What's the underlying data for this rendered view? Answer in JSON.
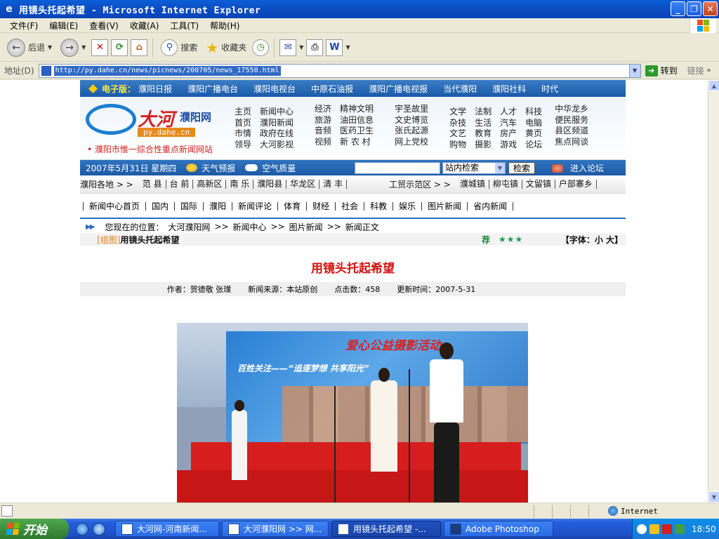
{
  "window": {
    "title": "用镜头托起希望 - Microsoft Internet Explorer",
    "buttons": [
      "_",
      "❐",
      "✕"
    ]
  },
  "menu": [
    "文件(F)",
    "编辑(E)",
    "查看(V)",
    "收藏(A)",
    "工具(T)",
    "帮助(H)"
  ],
  "toolbar": {
    "back": "后退",
    "search": "搜索",
    "favorites": "收藏夹"
  },
  "address": {
    "label": "地址(D)",
    "url": "http://py.dahe.cn/news/picnews/200705/news_17550.html",
    "go": "转到",
    "links": "链接"
  },
  "site": {
    "epaper_label": "电子版：",
    "epaper_items": [
      "濮阳日报",
      "濮阳广播电台",
      "濮阳电视台",
      "中原石油报",
      "濮阳广播电视报",
      "当代濮阳",
      "濮阳社科",
      "时代"
    ],
    "logo_big": "大河",
    "logo_small": "濮阳网",
    "logo_domain": "py.dahe.cn",
    "slogan": "• 濮阳市惟一综合性重点新闻网站",
    "nav_cols": [
      [
        "主页",
        "首页",
        "市情",
        "领导"
      ],
      [
        "新闻中心",
        "濮阳新闻",
        "政府在线",
        "大河影视"
      ],
      [
        "经济",
        "旅游",
        "音频",
        "视频"
      ],
      [
        "精神文明",
        "油田信息",
        "医药卫生",
        "新 农 村"
      ],
      [
        "宇圣故里",
        "文史博览",
        "张氏起源",
        "网上党校"
      ],
      [
        "文学",
        "杂技",
        "文艺",
        "购物"
      ],
      [
        "法制",
        "生活",
        "教育",
        "摄影"
      ],
      [
        "人才",
        "汽车",
        "房产",
        "游戏"
      ],
      [
        "科技",
        "电脑",
        "黄页",
        "论坛"
      ],
      [
        "中华龙乡",
        "便民服务",
        "县区频道",
        "焦点网谈"
      ]
    ],
    "date": "2007年5月31日 星期四",
    "weather": "天气预报",
    "air": "空气质量",
    "search_select": "站内检索",
    "search_button": "检索",
    "forum": "进入论坛",
    "region_label": "濮阳各地 > >",
    "regions": [
      "范 县",
      "台 前",
      "高新区",
      "南 乐",
      "濮阳县",
      "华龙区",
      "清 丰"
    ],
    "zone_label": "工贸示范区 > >",
    "zones": [
      "濮城镇",
      "柳屯镇",
      "文留镇",
      "户部寨乡"
    ],
    "categories": [
      "新闻中心首页",
      "国内",
      "国际",
      "濮阳",
      "新闻评论",
      "体育",
      "财经",
      "社会",
      "科教",
      "娱乐",
      "图片新闻",
      "省内新闻"
    ],
    "crumb_prefix": "您现在的位置：",
    "crumbs": [
      "大河濮阳网",
      "新闻中心",
      "图片新闻",
      "新闻正文"
    ],
    "article_tag": "[组图]",
    "article_title": "用镜头托起希望",
    "recommend": "荐",
    "stars": "★★★",
    "font_size": "【字体：小 大】",
    "headline": "用镜头托起希望",
    "author": "作者：贺德敬 张璞",
    "source": "新闻来源：本站原创",
    "hits": "点击数：458",
    "updated": "更新时间：2007-5-31",
    "photo_banner": "爱心公益摄影活动",
    "photo_sub": "百姓关注——“追逐梦想  共享阳光”"
  },
  "status": {
    "zone": "Internet"
  },
  "taskbar": {
    "start": "开始",
    "tasks": [
      "大河网-河南新闻...",
      "大河濮阳网 >> 网...",
      "用镜头托起希望 -...",
      "Adobe Photoshop"
    ],
    "clock": "18:50"
  }
}
